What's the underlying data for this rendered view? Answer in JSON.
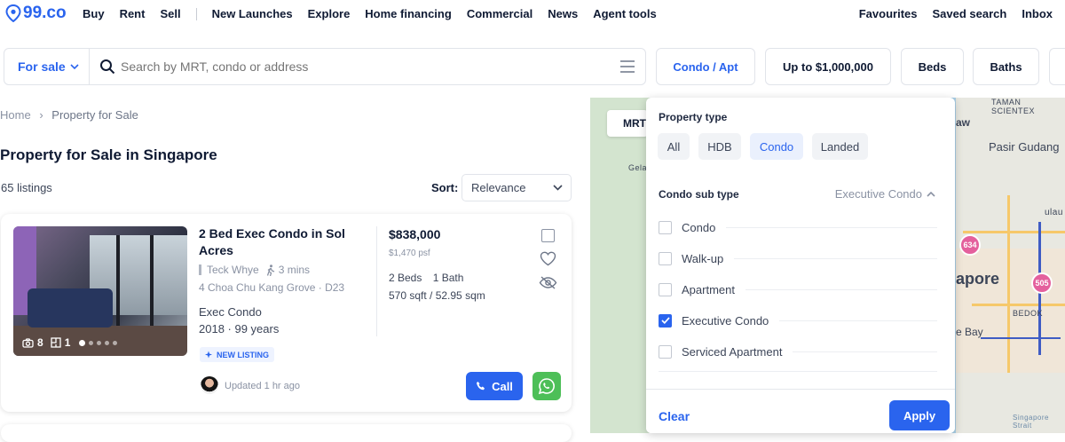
{
  "brand": {
    "name": "99.co",
    "accent": "#2a64ee"
  },
  "nav": {
    "left": [
      "Buy",
      "Rent",
      "Sell"
    ],
    "mid": [
      "New Launches",
      "Explore",
      "Home financing",
      "Commercial",
      "News",
      "Agent tools"
    ],
    "right": [
      "Favourites",
      "Saved search",
      "Inbox"
    ]
  },
  "search": {
    "mode": "For sale",
    "placeholder": "Search by MRT, condo or address"
  },
  "filters": [
    "Condo / Apt",
    "Up to $1,000,000",
    "Beds",
    "Baths"
  ],
  "breadcrumb": {
    "home": "Home",
    "current": "Property for Sale"
  },
  "page_title": "Property for Sale in Singapore",
  "listing_count": "65 listings",
  "sort": {
    "label": "Sort:",
    "value": "Relevance"
  },
  "listing": {
    "title": "2 Bed Exec Condo in Sol Acres",
    "mrt": "Teck Whye",
    "walk": "3 mins",
    "address": "4 Choa Chu Kang Grove · D23",
    "type": "Exec Condo",
    "year_tenure": "2018 · 99 years",
    "badge": "NEW LISTING",
    "photos": "8",
    "floorplans": "1",
    "price": "$838,000",
    "psf": "$1,470 psf",
    "beds": "2 Beds",
    "baths": "1 Bath",
    "size": "570 sqft / 52.95 sqm",
    "updated": "Updated 1 hr ago",
    "call_label": "Call"
  },
  "map": {
    "mrt_label": "MRT",
    "labels": [
      "TAMAN SCIENTEX",
      "Pasir Gudang",
      "Gela",
      "apore",
      "BEDOK",
      "e Bay",
      "aw",
      "ulau",
      "Singapore Strait"
    ],
    "pins": [
      "634",
      "505"
    ]
  },
  "panel": {
    "property_type_label": "Property type",
    "property_types": [
      "All",
      "HDB",
      "Condo",
      "Landed"
    ],
    "property_type_selected": "Condo",
    "subtype_label": "Condo sub type",
    "subtype_value": "Executive Condo",
    "options": [
      {
        "label": "Condo",
        "checked": false
      },
      {
        "label": "Walk-up",
        "checked": false
      },
      {
        "label": "Apartment",
        "checked": false
      },
      {
        "label": "Executive Condo",
        "checked": true
      },
      {
        "label": "Serviced Apartment",
        "checked": false
      }
    ],
    "clear_label": "Clear",
    "apply_label": "Apply"
  }
}
